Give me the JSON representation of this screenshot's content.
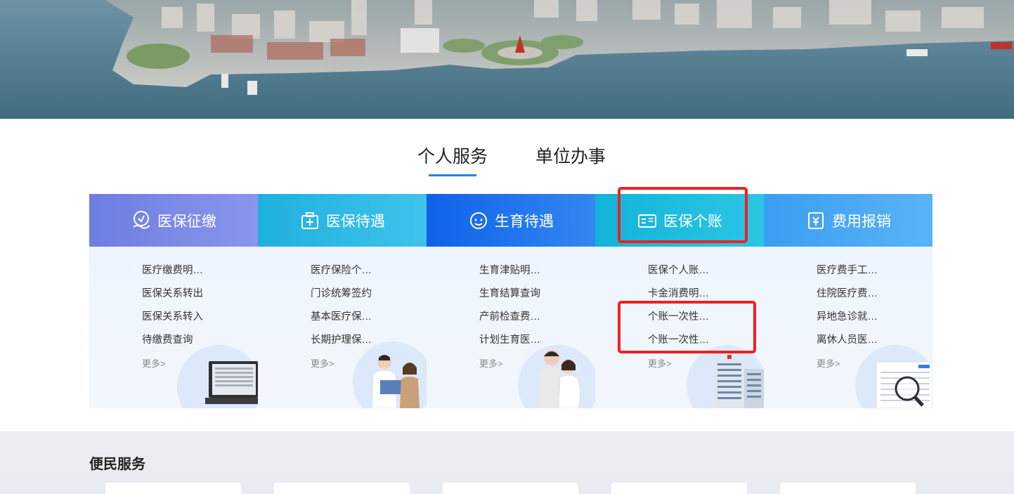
{
  "tabs": [
    {
      "label": "个人服务",
      "active": true
    },
    {
      "label": "单位办事",
      "active": false
    }
  ],
  "cards": [
    {
      "title": "医保征缴",
      "icon": "medical-payment-icon",
      "items": [
        "医疗缴费明…",
        "医保关系转出",
        "医保关系转入",
        "待缴费查询"
      ],
      "more": "更多>"
    },
    {
      "title": "医保待遇",
      "icon": "medical-kit-icon",
      "items": [
        "医疗保险个…",
        "门诊统筹签约",
        "基本医疗保…",
        "长期护理保…"
      ],
      "more": "更多>"
    },
    {
      "title": "生育待遇",
      "icon": "baby-face-icon",
      "items": [
        "生育津贴明…",
        "生育结算查询",
        "产前检查费…",
        "计划生育医…"
      ],
      "more": "更多>"
    },
    {
      "title": "医保个账",
      "icon": "account-card-icon",
      "items": [
        "医保个人账…",
        "卡金消费明…",
        "个账一次性…",
        "个账一次性…"
      ],
      "more": "更多>"
    },
    {
      "title": "费用报销",
      "icon": "reimbursement-icon",
      "items": [
        "医疗费手工…",
        "住院医疗费…",
        "异地急诊就…",
        "离休人员医…"
      ],
      "more": "更多>"
    }
  ],
  "bottom": {
    "title": "便民服务"
  },
  "colors": {
    "accent": "#2f7de1",
    "highlight": "#f02020"
  }
}
